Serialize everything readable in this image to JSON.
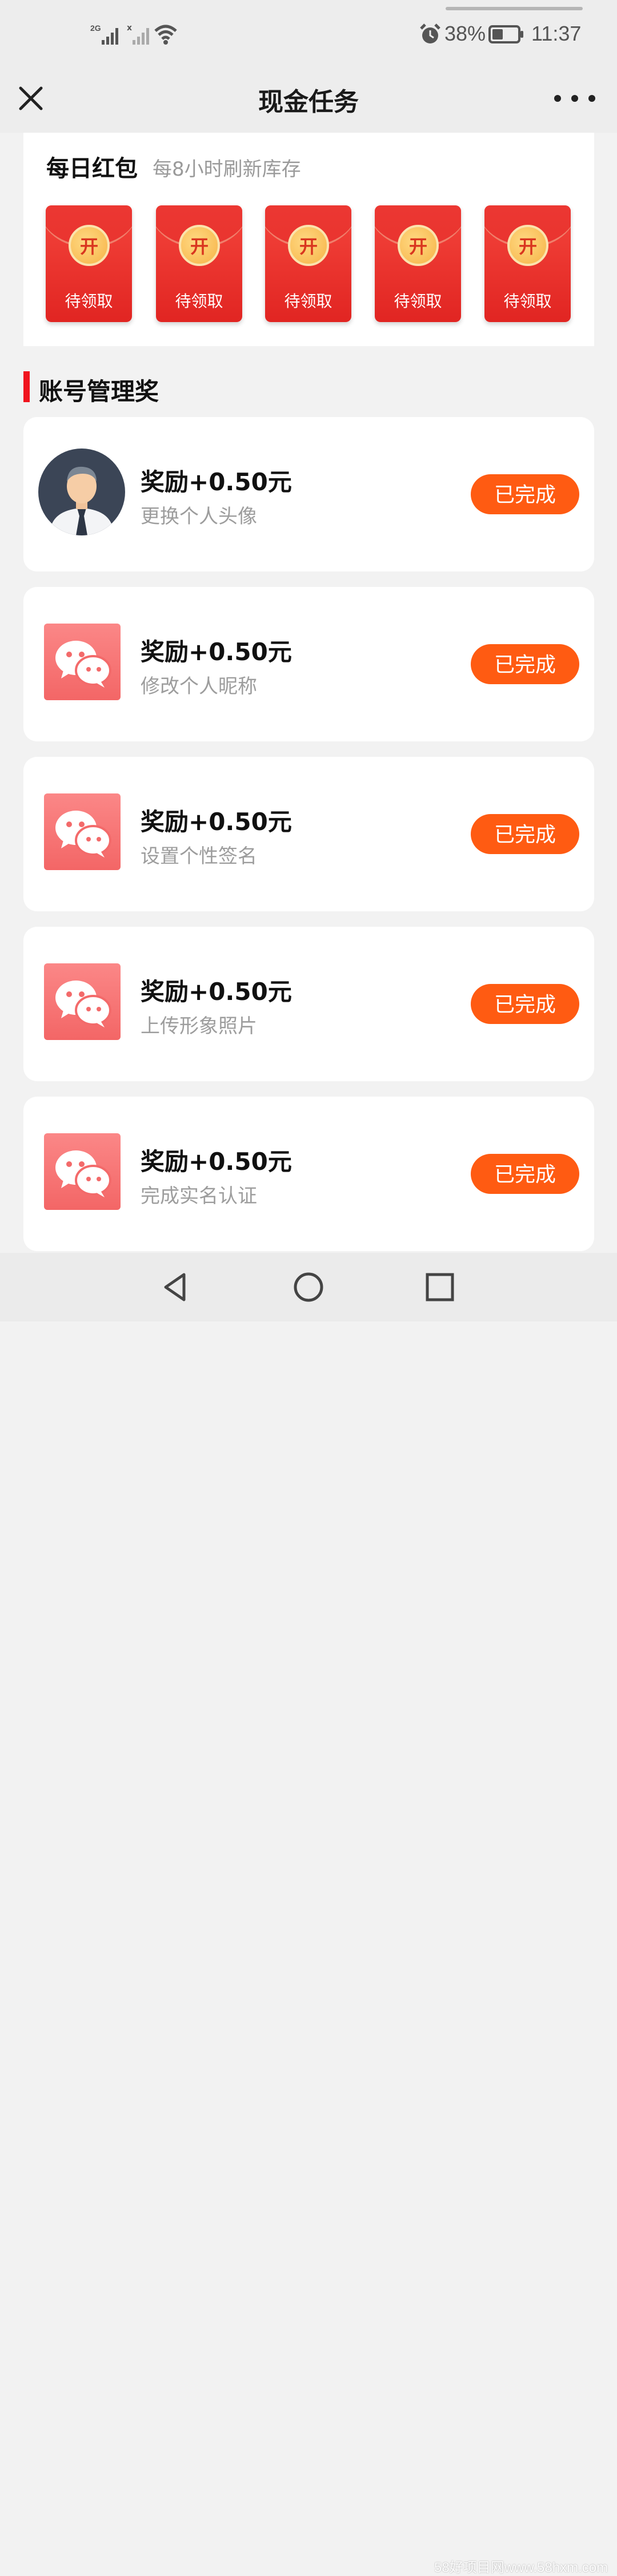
{
  "status_bar": {
    "network_label": "2G",
    "battery_percent": "38%",
    "time": "11:37"
  },
  "header": {
    "title": "现金任务",
    "close_icon": "close-icon",
    "more_icon": "more-icon"
  },
  "daily_red_packet": {
    "title": "每日红包",
    "subtitle": "每8小时刷新库存",
    "packets": [
      {
        "open_char": "开",
        "status": "待领取"
      },
      {
        "open_char": "开",
        "status": "待领取"
      },
      {
        "open_char": "开",
        "status": "待领取"
      },
      {
        "open_char": "开",
        "status": "待领取"
      },
      {
        "open_char": "开",
        "status": "待领取"
      }
    ]
  },
  "account_section": {
    "title": "账号管理奖",
    "accent_color": "#f0141e",
    "tasks": [
      {
        "icon": "avatar-icon",
        "reward": "奖励+0.50元",
        "name": "更换个人头像",
        "button": "已完成"
      },
      {
        "icon": "wechat-icon",
        "reward": "奖励+0.50元",
        "name": "修改个人昵称",
        "button": "已完成"
      },
      {
        "icon": "wechat-icon",
        "reward": "奖励+0.50元",
        "name": "设置个性签名",
        "button": "已完成"
      },
      {
        "icon": "wechat-icon",
        "reward": "奖励+0.50元",
        "name": "上传形象照片",
        "button": "已完成"
      },
      {
        "icon": "wechat-icon",
        "reward": "奖励+0.50元",
        "name": "完成实名认证",
        "button": "已完成"
      }
    ],
    "button_color": "#ff5b12"
  },
  "nav_bar": {
    "back_icon": "back-triangle-icon",
    "home_icon": "home-circle-icon",
    "recents_icon": "recents-square-icon"
  },
  "watermark": "58好项目网www.58hxm.com"
}
